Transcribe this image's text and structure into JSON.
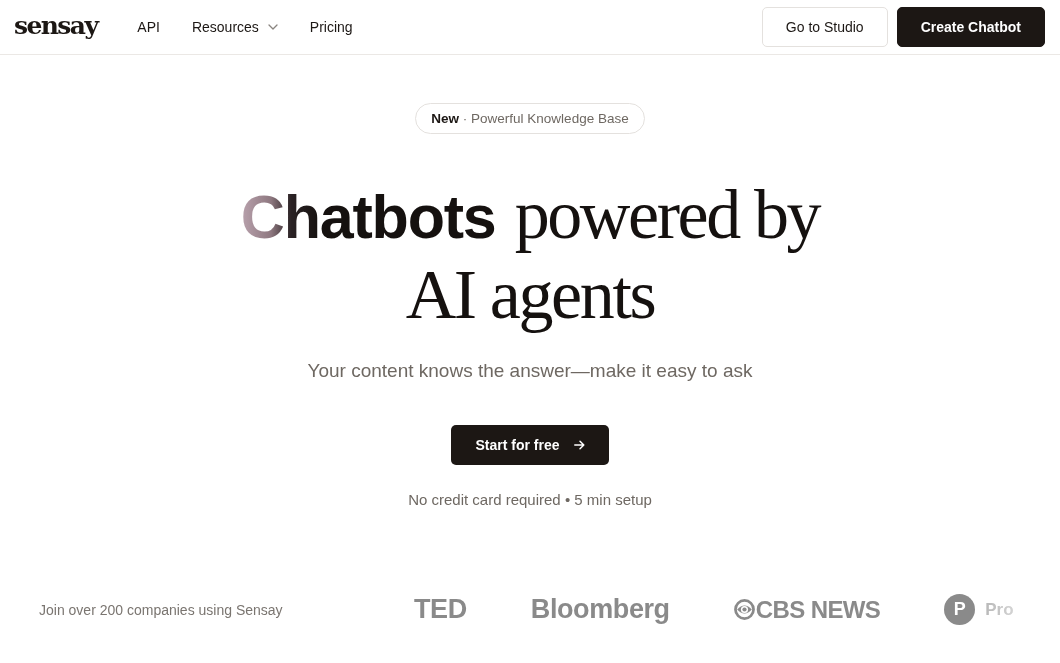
{
  "header": {
    "logo": "sensay",
    "nav": [
      {
        "label": "API",
        "kind": "link"
      },
      {
        "label": "Resources",
        "kind": "dropdown"
      },
      {
        "label": "Pricing",
        "kind": "link"
      }
    ],
    "buttons": [
      {
        "label": "Go to Studio",
        "kind": "outline"
      },
      {
        "label": "Create Chatbot",
        "kind": "primary"
      }
    ]
  },
  "hero": {
    "badge": "**New** · Powerful Knowledge Base",
    "headline": [
      "**Chatbots** powered by",
      "AI agents"
    ],
    "subtitle": "Your content knows the answer—make it easy to ask",
    "cta": {
      "label": "Start for free"
    },
    "note": "No credit card required • 5 min setup"
  },
  "logo_strip": {
    "label": "Join over 200 companies using Sensay",
    "logos": [
      {
        "kind": "wordmark",
        "text": "TED"
      },
      {
        "kind": "wordmark",
        "text": "Bloomberg"
      },
      {
        "kind": "eye_wordmark",
        "text": "CBS NEWS"
      },
      {
        "kind": "monogram_wordmark",
        "monogram": "P",
        "text": "Pro"
      }
    ]
  }
}
